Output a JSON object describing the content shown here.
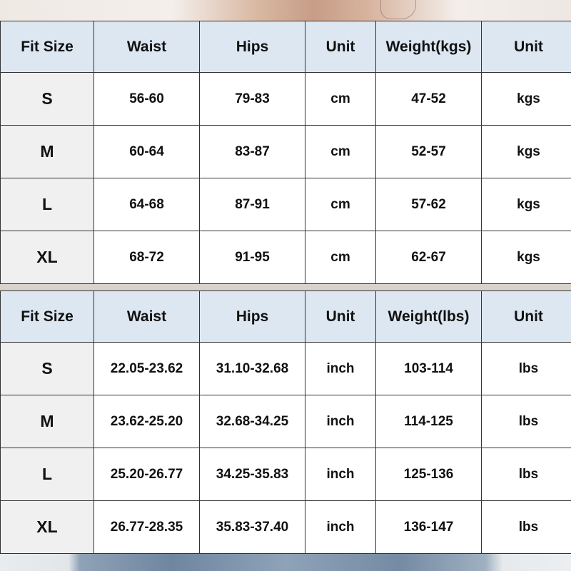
{
  "tables": [
    {
      "headers": [
        "Fit Size",
        "Waist",
        "Hips",
        "Unit",
        "Weight(kgs)",
        "Unit"
      ],
      "rows": [
        [
          "S",
          "56-60",
          "79-83",
          "cm",
          "47-52",
          "kgs"
        ],
        [
          "M",
          "60-64",
          "83-87",
          "cm",
          "52-57",
          "kgs"
        ],
        [
          "L",
          "64-68",
          "87-91",
          "cm",
          "57-62",
          "kgs"
        ],
        [
          "XL",
          "68-72",
          "91-95",
          "cm",
          "62-67",
          "kgs"
        ]
      ]
    },
    {
      "headers": [
        "Fit Size",
        "Waist",
        "Hips",
        "Unit",
        "Weight(lbs)",
        "Unit"
      ],
      "rows": [
        [
          "S",
          "22.05-23.62",
          "31.10-32.68",
          "inch",
          "103-114",
          "lbs"
        ],
        [
          "M",
          "23.62-25.20",
          "32.68-34.25",
          "inch",
          "114-125",
          "lbs"
        ],
        [
          "L",
          "25.20-26.77",
          "34.25-35.83",
          "inch",
          "125-136",
          "lbs"
        ],
        [
          "XL",
          "26.77-28.35",
          "35.83-37.40",
          "inch",
          "136-147",
          "lbs"
        ]
      ]
    }
  ],
  "colors": {
    "header_bg": "#dde7f1",
    "label_bg": "#f0f0f0",
    "border": "#333333"
  }
}
